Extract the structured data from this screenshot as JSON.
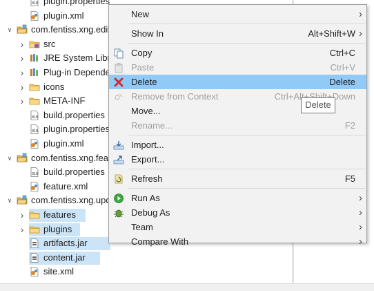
{
  "tree": {
    "rows": [
      {
        "label": "plugin.properties",
        "icon": "properties-file-icon",
        "twisty": ""
      },
      {
        "label": "plugin.xml",
        "icon": "plugin-xml-icon",
        "twisty": ""
      },
      {
        "label": "com.fentiss.xng.edit",
        "icon": "plugin-project-icon",
        "twisty": "expanded"
      },
      {
        "label": "src",
        "icon": "source-folder-icon",
        "twisty": "collapsed"
      },
      {
        "label": "JRE System Library",
        "icon": "library-icon",
        "twisty": "collapsed"
      },
      {
        "label": "Plug-in Dependencies",
        "icon": "library-icon",
        "twisty": "collapsed"
      },
      {
        "label": "icons",
        "icon": "folder-icon",
        "twisty": "collapsed"
      },
      {
        "label": "META-INF",
        "icon": "folder-icon",
        "twisty": "collapsed"
      },
      {
        "label": "build.properties",
        "icon": "properties-file-icon",
        "twisty": ""
      },
      {
        "label": "plugin.properties",
        "icon": "properties-file-icon",
        "twisty": ""
      },
      {
        "label": "plugin.xml",
        "icon": "plugin-xml-icon",
        "twisty": ""
      },
      {
        "label": "com.fentiss.xng.feature",
        "icon": "feature-project-icon",
        "twisty": "expanded"
      },
      {
        "label": "build.properties",
        "icon": "properties-file-icon",
        "twisty": ""
      },
      {
        "label": "feature.xml",
        "icon": "feature-xml-icon",
        "twisty": ""
      },
      {
        "label": "com.fentiss.xng.update",
        "icon": "update-site-project-icon",
        "twisty": "expanded"
      },
      {
        "label": "features",
        "icon": "folder-icon",
        "twisty": "collapsed",
        "selected": true
      },
      {
        "label": "plugins",
        "icon": "folder-icon",
        "twisty": "collapsed",
        "selected": true
      },
      {
        "label": "artifacts.jar",
        "icon": "jar-file-icon",
        "twisty": "",
        "selected": true
      },
      {
        "label": "content.jar",
        "icon": "jar-file-icon",
        "twisty": "",
        "selected": true
      },
      {
        "label": "site.xml",
        "icon": "site-xml-icon",
        "twisty": ""
      }
    ]
  },
  "menu": {
    "items": [
      {
        "label": "New",
        "key": "",
        "submenu": true,
        "icon": ""
      },
      {
        "separator": true
      },
      {
        "label": "Show In",
        "key": "Alt+Shift+W",
        "submenu": true,
        "icon": ""
      },
      {
        "separator": true
      },
      {
        "label": "Copy",
        "key": "Ctrl+C",
        "icon": "copy-icon"
      },
      {
        "label": "Paste",
        "key": "Ctrl+V",
        "icon": "paste-icon",
        "disabled": true
      },
      {
        "label": "Delete",
        "key": "Delete",
        "icon": "delete-icon",
        "hover": true
      },
      {
        "label": "Remove from Context",
        "key": "Ctrl+Alt+Shift+Down",
        "icon": "remove-context-icon",
        "disabled": true
      },
      {
        "label": "Move...",
        "key": "",
        "icon": ""
      },
      {
        "label": "Rename...",
        "key": "F2",
        "icon": "",
        "disabled": true
      },
      {
        "separator": true
      },
      {
        "label": "Import...",
        "key": "",
        "icon": "import-icon"
      },
      {
        "label": "Export...",
        "key": "",
        "icon": "export-icon"
      },
      {
        "separator": true
      },
      {
        "label": "Refresh",
        "key": "F5",
        "icon": "refresh-icon"
      },
      {
        "separator": true
      },
      {
        "label": "Run As",
        "key": "",
        "submenu": true,
        "icon": "run-icon"
      },
      {
        "label": "Debug As",
        "key": "",
        "submenu": true,
        "icon": "debug-icon"
      },
      {
        "label": "Team",
        "key": "",
        "submenu": true,
        "icon": ""
      },
      {
        "label": "Compare With",
        "key": "",
        "submenu": true,
        "icon": ""
      }
    ]
  },
  "tooltip": {
    "text": "Delete"
  },
  "colors": {
    "selection": "#cce4f7",
    "menu_hover": "#91c9f7",
    "menu_bg": "#f2f2f2",
    "disabled_text": "#a0a0a0"
  }
}
